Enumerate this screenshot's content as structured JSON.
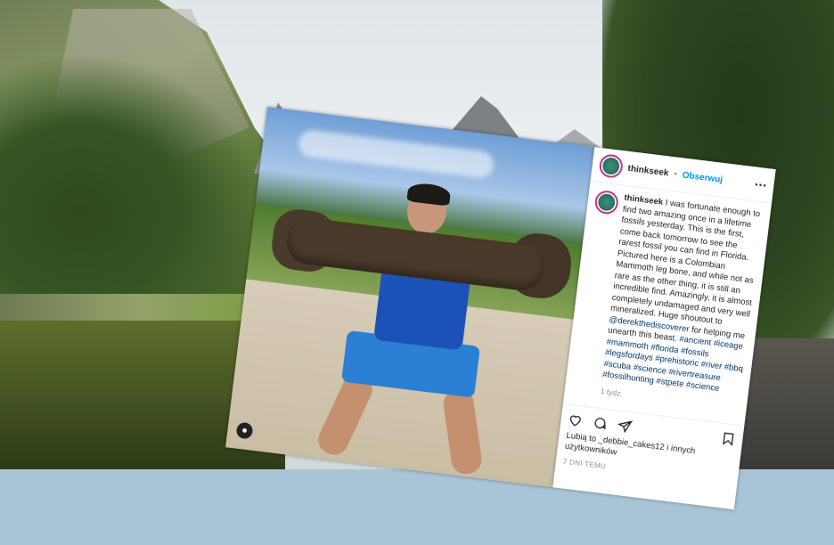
{
  "post": {
    "username": "thinkseek",
    "follow_label": "Obserwuj",
    "caption_parts": {
      "text1": "I was fortunate enough to find two amazing once in a lifetime fossils yesterday. This is the first, come back tomorrow to see the rarest fossil you can find in Florida. Pictured here is a Colombian Mammoth leg bone, and while not as rare as the other thing, it is still an incredible find. Amazingly, it is almost completely undamaged and very well mineralized. Huge shoutout to ",
      "mention": "@derekthediscoverer",
      "text2": " for helping me unearth this beast. ",
      "hashtags": "#ancient #iceage #mammoth #florida #fossils #legsfordays #prehistoric #river #bbq #scuba #science #rivertreasure #fossilhunting #stpete #science"
    },
    "time_ago": "1 tydz.",
    "likes_text": "Lubią to _debbie_cakes12 i innych użytkowników",
    "posted": "7 DNI TEMU",
    "colors": {
      "link": "#00376b",
      "follow": "#0095f6"
    },
    "icons": [
      "heart-icon",
      "comment-icon",
      "share-icon",
      "bookmark-icon",
      "more-icon",
      "user-tag-icon"
    ]
  }
}
